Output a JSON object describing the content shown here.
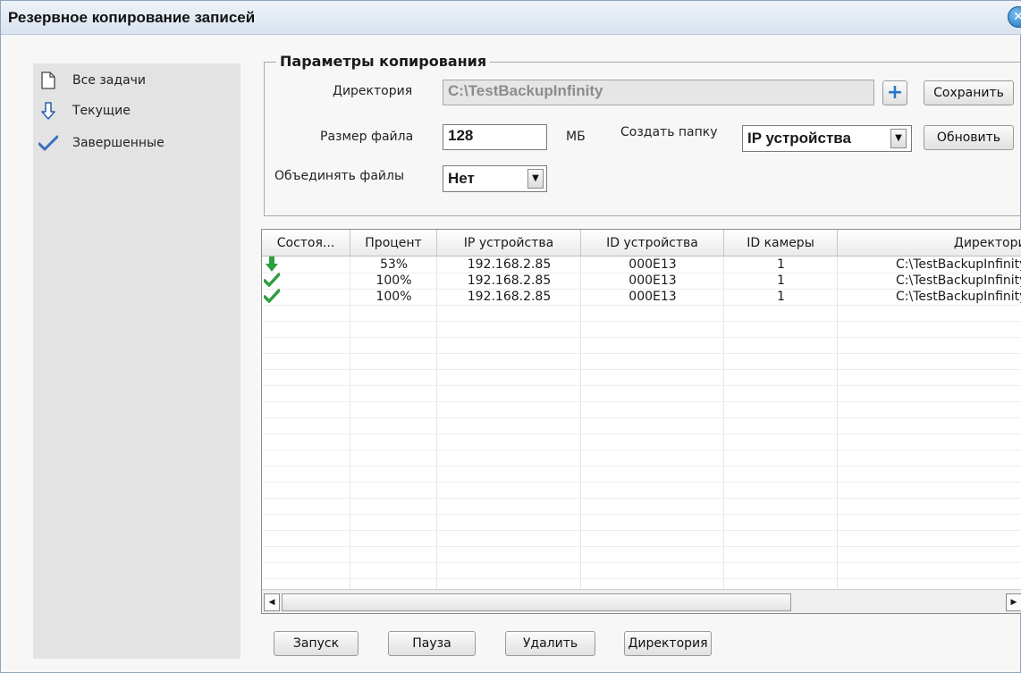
{
  "window": {
    "title": "Резервное копирование записей",
    "close_glyph": "✕"
  },
  "sidebar": {
    "items": [
      {
        "label": "Все задачи",
        "icon": "document-icon"
      },
      {
        "label": "Текущие",
        "icon": "arrow-down-icon"
      },
      {
        "label": "Завершенные",
        "icon": "checkmark-icon"
      }
    ]
  },
  "params": {
    "group_title": "Параметры копирования",
    "directory_label": "Директория",
    "directory_value": "C:\\TestBackupInfinity",
    "add_label": "+",
    "save_label": "Сохранить",
    "file_size_label": "Размер файла",
    "file_size_value": "128",
    "file_size_unit": "МБ",
    "create_folder_label": "Создать папку",
    "create_folder_value": "IP устройства",
    "refresh_label": "Обновить",
    "merge_files_label": "Объединять файлы",
    "merge_files_value": "Нет"
  },
  "table": {
    "columns": [
      "Состоя...",
      "Процент",
      "IP устройства",
      "ID устройства",
      "ID камеры",
      "Директория"
    ],
    "rows": [
      {
        "status": "in-progress",
        "percent": "53%",
        "ip": "192.168.2.85",
        "device_id": "000E13",
        "camera_id": "1",
        "directory": "C:\\TestBackupInfinity"
      },
      {
        "status": "done",
        "percent": "100%",
        "ip": "192.168.2.85",
        "device_id": "000E13",
        "camera_id": "1",
        "directory": "C:\\TestBackupInfinity"
      },
      {
        "status": "done",
        "percent": "100%",
        "ip": "192.168.2.85",
        "device_id": "000E13",
        "camera_id": "1",
        "directory": "C:\\TestBackupInfinity"
      }
    ]
  },
  "actions": {
    "start": "Запуск",
    "pause": "Пауза",
    "delete": "Удалить",
    "directory": "Директория"
  },
  "colors": {
    "status_green": "#2e9e3e",
    "accent_blue": "#2a77c9",
    "title_bar": "#dde6f0",
    "sidebar_bg": "#e3e3e3"
  }
}
